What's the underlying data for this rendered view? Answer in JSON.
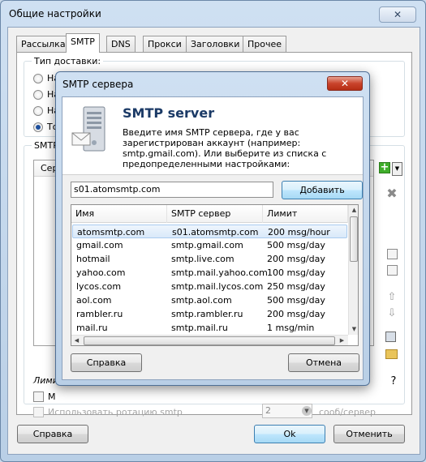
{
  "outer_window": {
    "title": "Общие настройки",
    "close_glyph": "✕",
    "tabs": [
      "Рассылка",
      "SMTP",
      "DNS",
      "Прокси",
      "Заголовки",
      "Прочее"
    ],
    "active_tab": "SMTP",
    "delivery_label": "Тип доставки:",
    "radio_fragments": [
      "На",
      "На",
      "На",
      "То"
    ],
    "smtp_group_fragment": "SMTP",
    "list_header_fragment": "Серв",
    "limit_fragment": "Лими",
    "check_fragment": "М",
    "rotation_label": "Использовать ротацию smtp",
    "rotation_value": "2",
    "per_server_label": "сооб/сервер",
    "help_glyph": "?",
    "buttons": {
      "help": "Справка",
      "ok": "Ok",
      "cancel": "Отменить"
    }
  },
  "modal": {
    "title": "SMTP сервера",
    "close_glyph": "✕",
    "heading": "SMTP server",
    "description": "Введите имя SMTP сервера, где у вас зарегистрирован аккаунт (например: smtp.gmail.com). Или выберите из списка с предопределенными настройками:",
    "server_input_value": "s01.atomsmtp.com",
    "add_button": "Добавить",
    "columns": [
      "Имя",
      "SMTP сервер",
      "Лимит"
    ],
    "rows": [
      {
        "name": "atomsmtp.com",
        "server": "s01.atomsmtp.com",
        "limit": "200 msg/hour"
      },
      {
        "name": "gmail.com",
        "server": "smtp.gmail.com",
        "limit": "500 msg/day"
      },
      {
        "name": "hotmail",
        "server": "smtp.live.com",
        "limit": "200 msg/day"
      },
      {
        "name": "yahoo.com",
        "server": "smtp.mail.yahoo.com",
        "limit": "100 msg/day"
      },
      {
        "name": "lycos.com",
        "server": "smtp.mail.lycos.com",
        "limit": "250 msg/day"
      },
      {
        "name": "aol.com",
        "server": "smtp.aol.com",
        "limit": "500 msg/day"
      },
      {
        "name": "rambler.ru",
        "server": "smtp.rambler.ru",
        "limit": "200 msg/day"
      },
      {
        "name": "mail.ru",
        "server": "smtp.mail.ru",
        "limit": "1 msg/min"
      }
    ],
    "selected_row": 0,
    "buttons": {
      "help": "Справка",
      "cancel": "Отмена"
    }
  },
  "colors": {
    "accent": "#1b3a66",
    "selection": "#d9e9f9",
    "close_red": "#c9432b"
  }
}
